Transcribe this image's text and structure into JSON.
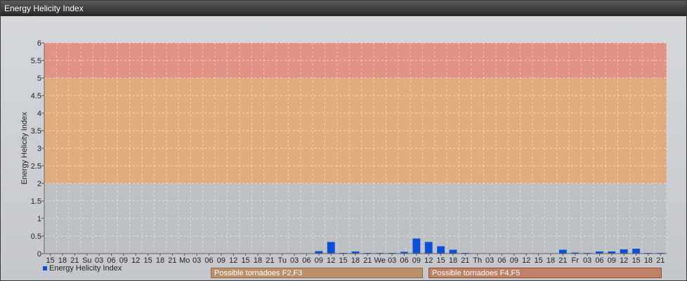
{
  "window": {
    "title": "Energy Helicity Index"
  },
  "chart_data": {
    "type": "bar",
    "ylabel": "Energy Helicity Index",
    "ylim": [
      0,
      6
    ],
    "yticks": [
      "0",
      "0.5",
      "1",
      "1.5",
      "2",
      "2.5",
      "3",
      "3.5",
      "4",
      "4.5",
      "5",
      "5.5",
      "6"
    ],
    "categories": [
      "15",
      "18",
      "21",
      "Su",
      "03",
      "06",
      "09",
      "12",
      "15",
      "18",
      "21",
      "Mo",
      "03",
      "06",
      "09",
      "12",
      "15",
      "18",
      "21",
      "Tu",
      "03",
      "06",
      "09",
      "12",
      "15",
      "18",
      "21",
      "We",
      "03",
      "06",
      "09",
      "12",
      "15",
      "18",
      "21",
      "Th",
      "03",
      "06",
      "09",
      "12",
      "15",
      "18",
      "21",
      "Fr",
      "03",
      "06",
      "09",
      "12",
      "15",
      "18",
      "21"
    ],
    "series": [
      {
        "name": "Energy Helicity Index",
        "color": "#0a4fd8",
        "values": [
          0.01,
          0.01,
          0.01,
          0.01,
          0.01,
          0.01,
          0.01,
          0.01,
          0.01,
          0.01,
          0.01,
          0.01,
          0.01,
          0.01,
          0.01,
          0.01,
          0.01,
          0.01,
          0.01,
          0.01,
          0.01,
          0.01,
          0.07,
          0.33,
          0.02,
          0.06,
          0.02,
          0.02,
          0.02,
          0.05,
          0.43,
          0.33,
          0.21,
          0.11,
          0.02,
          0.01,
          0.01,
          0.01,
          0.01,
          0.01,
          0.01,
          0.01,
          0.11,
          0.03,
          0.02,
          0.06,
          0.06,
          0.12,
          0.14,
          0.02,
          0.02
        ]
      }
    ],
    "bands": [
      {
        "from": 2,
        "to": 5,
        "color": "#e8a870"
      },
      {
        "from": 5,
        "to": 6,
        "color": "#e88c78"
      }
    ],
    "grid": true,
    "legend": "bottom-left"
  },
  "zones": [
    {
      "label": "Possible tornadoes F2,F3"
    },
    {
      "label": "Possible tornadoes F4,F5"
    }
  ]
}
